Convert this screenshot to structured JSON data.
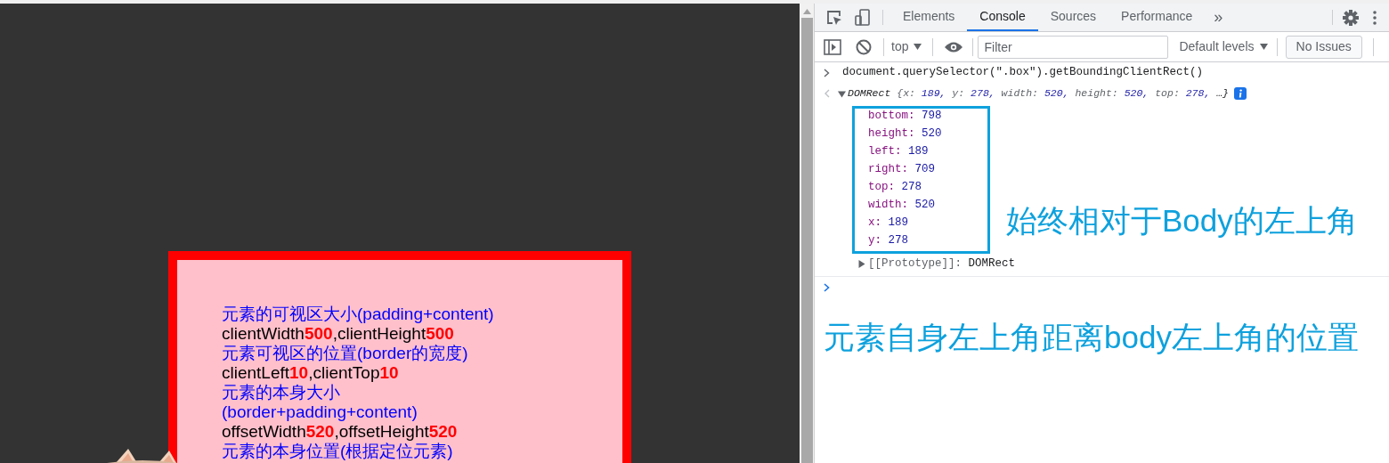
{
  "page": {
    "box_lines": [
      {
        "kind": "heading",
        "text": "元素的可视区大小(padding+content)"
      },
      {
        "kind": "metric",
        "text": "clientWidth**500**,clientHeight**500**"
      },
      {
        "kind": "heading",
        "text": "元素可视区的位置(border的宽度)"
      },
      {
        "kind": "metric",
        "text": "clientLeft**10**,clientTop**10**"
      },
      {
        "kind": "heading",
        "text": "元素的本身大小"
      },
      {
        "kind": "heading",
        "text": "(border+padding+content)"
      },
      {
        "kind": "metric",
        "text": "offsetWidth**520**,offsetHeight**520**"
      },
      {
        "kind": "heading",
        "text": "元素的本身位置(根据定位元素)"
      }
    ]
  },
  "devtools": {
    "tabs": [
      {
        "label": "Elements",
        "selected": false
      },
      {
        "label": "Console",
        "selected": true
      },
      {
        "label": "Sources",
        "selected": false
      },
      {
        "label": "Performance",
        "selected": false
      }
    ],
    "more_tabs": "»",
    "console_toolbar": {
      "context": "top",
      "filter_placeholder": "Filter",
      "levels": "Default levels",
      "issues": "No Issues"
    },
    "console": {
      "command": "document.querySelector(\".box\").getBoundingClientRect()",
      "result": {
        "expanded": true,
        "class_name": "DOMRect",
        "open": "{",
        "fields": [
          {
            "key": "x:",
            "value": "189,"
          },
          {
            "key": "y:",
            "value": "278,"
          },
          {
            "key": "width:",
            "value": "520,"
          },
          {
            "key": "height:",
            "value": "520,"
          },
          {
            "key": "top:",
            "value": "278,"
          }
        ],
        "close": "…}"
      },
      "properties": [
        {
          "key": "bottom:",
          "value": "798"
        },
        {
          "key": "height:",
          "value": "520"
        },
        {
          "key": "left:",
          "value": "189"
        },
        {
          "key": "right:",
          "value": "709"
        },
        {
          "key": "top:",
          "value": "278"
        },
        {
          "key": "width:",
          "value": "520"
        },
        {
          "key": "x:",
          "value": "189"
        },
        {
          "key": "y:",
          "value": "278"
        }
      ],
      "prototype": {
        "key": "[[Prototype]]:",
        "value": "DOMRect",
        "expanded": false
      }
    }
  },
  "annotations": [
    "始终相对于Body的左上角",
    "元素自身左上角距离body左上角的位置"
  ]
}
